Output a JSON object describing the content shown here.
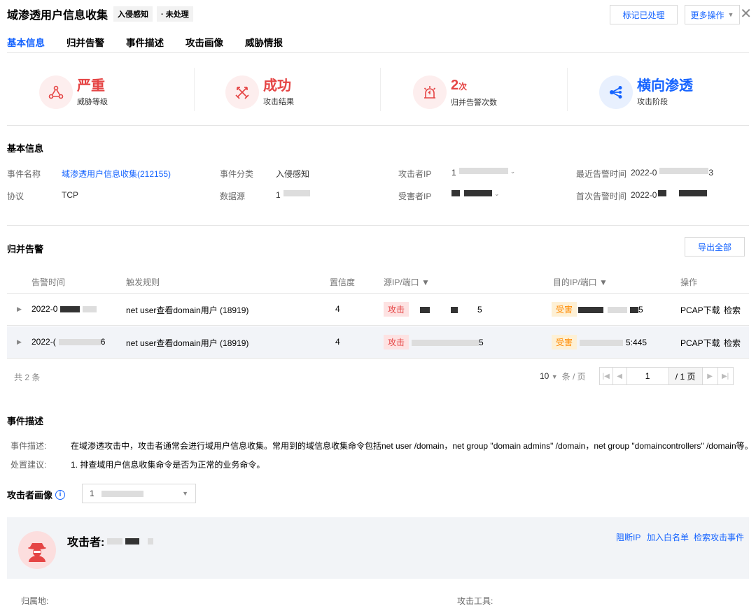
{
  "header": {
    "title": "域渗透用户信息收集",
    "tag_category": "入侵感知",
    "tag_status": "· 未处理",
    "mark_button": "标记已处理",
    "more_button": "更多操作",
    "close_symbol": "✕"
  },
  "tabs": [
    {
      "label": "基本信息",
      "active": true
    },
    {
      "label": "归并告警",
      "active": false
    },
    {
      "label": "事件描述",
      "active": false
    },
    {
      "label": "攻击画像",
      "active": false
    },
    {
      "label": "威胁情报",
      "active": false
    }
  ],
  "stats": [
    {
      "value": "严重",
      "unit": "",
      "label": "威胁等级",
      "icon": "molecule-icon",
      "color": "#e54545"
    },
    {
      "value": "成功",
      "unit": "",
      "label": "攻击结果",
      "icon": "crossed-swords-icon",
      "color": "#e54545"
    },
    {
      "value": "2",
      "unit": "次",
      "label": "归并告警次数",
      "icon": "alarm-icon",
      "color": "#e54545"
    },
    {
      "value": "横向渗透",
      "unit": "",
      "label": "攻击阶段",
      "icon": "share-nodes-icon",
      "color": "#1664ff"
    }
  ],
  "basic_info": {
    "section_title": "基本信息",
    "event_name_label": "事件名称",
    "event_name_value": "域渗透用户信息收集(212155)",
    "protocol_label": "协议",
    "protocol_value": "TCP",
    "category_label": "事件分类",
    "category_value": "入侵感知",
    "datasource_label": "数据源",
    "datasource_value": "1",
    "attacker_ip_label": "攻击者IP",
    "attacker_ip_value": "1",
    "victim_ip_label": "受害者IP",
    "recent_time_label": "最近告警时间",
    "recent_time_value": "2022-0",
    "recent_time_tail": "3",
    "first_time_label": "首次告警时间",
    "first_time_value": "2022-0"
  },
  "alerts": {
    "section_title": "归并告警",
    "export_button": "导出全部",
    "columns": [
      "告警时间",
      "触发规则",
      "置信度",
      "源IP/端口",
      "目的IP/端口",
      "操作"
    ],
    "rows": [
      {
        "time": "2022-0",
        "time_tail": "",
        "rule": "net user查看domain用户 (18919)",
        "confidence": "4",
        "src_tag": "攻击",
        "src_tail": "5",
        "dst_tag": "受害",
        "dst_tail": "5",
        "action_pcap": "PCAP下载",
        "action_search": "检索"
      },
      {
        "time": "2022-(",
        "time_tail": "6",
        "rule": "net user查看domain用户 (18919)",
        "confidence": "4",
        "src_tag": "攻击",
        "src_tail": "5",
        "dst_tag": "受害",
        "dst_tail": "5:445",
        "action_pcap": "PCAP下载",
        "action_search": "检索"
      }
    ],
    "total_text": "共 2 条",
    "page_size": "10",
    "per_page_text": "条 / 页",
    "current_page": "1",
    "total_pages_text": "/ 1 页"
  },
  "event_desc": {
    "section_title": "事件描述",
    "desc_label": "事件描述:",
    "desc_value": "在域渗透攻击中，攻击者通常会进行域用户信息收集。常用到的域信息收集命令包括net user /domain，net group \"domain admins\" /domain，net group \"domaincontrollers\" /domain等。",
    "advice_label": "处置建议:",
    "advice_value": "1. 排查域用户信息收集命令是否为正常的业务命令。"
  },
  "attacker_profile": {
    "section_title": "攻击者画像",
    "select_value": "1",
    "attacker_label": "攻击者:",
    "block_ip": "阻断IP",
    "add_whitelist": "加入白名单",
    "search_events": "检索攻击事件",
    "location_label": "归属地:",
    "tools_label": "攻击工具:"
  }
}
